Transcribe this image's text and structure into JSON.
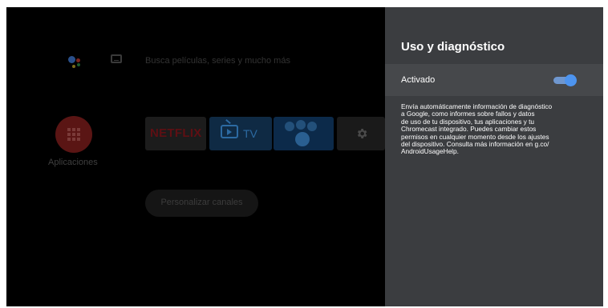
{
  "home": {
    "search_placeholder": "Busca películas, series y mucho más",
    "apps_label": "Aplicaciones",
    "netflix_label": "NETFLIX",
    "tv_label": "TV",
    "customize_channels_label": "Personalizar canales",
    "icons": [
      "google-assistant-icon",
      "keyboard-icon",
      "apps-grid-icon",
      "tv-icon",
      "photos-icon",
      "settings-gear-icon"
    ]
  },
  "panel": {
    "title": "Uso y diagnóstico",
    "toggle_label": "Activado",
    "toggle_state": "on",
    "accent_color": "#4d94ef",
    "description_lines": [
      "Envía automáticamente información de diagnóstico",
      "a Google, como informes sobre fallos y datos",
      "de uso de tu dispositivo, tus aplicaciones y tu",
      "Chromecast integrado. Puedes cambiar estos",
      "permisos en cualquier momento desde los ajustes",
      "del dispositivo. Consulta más información en g.co/",
      "AndroidUsageHelp."
    ]
  }
}
